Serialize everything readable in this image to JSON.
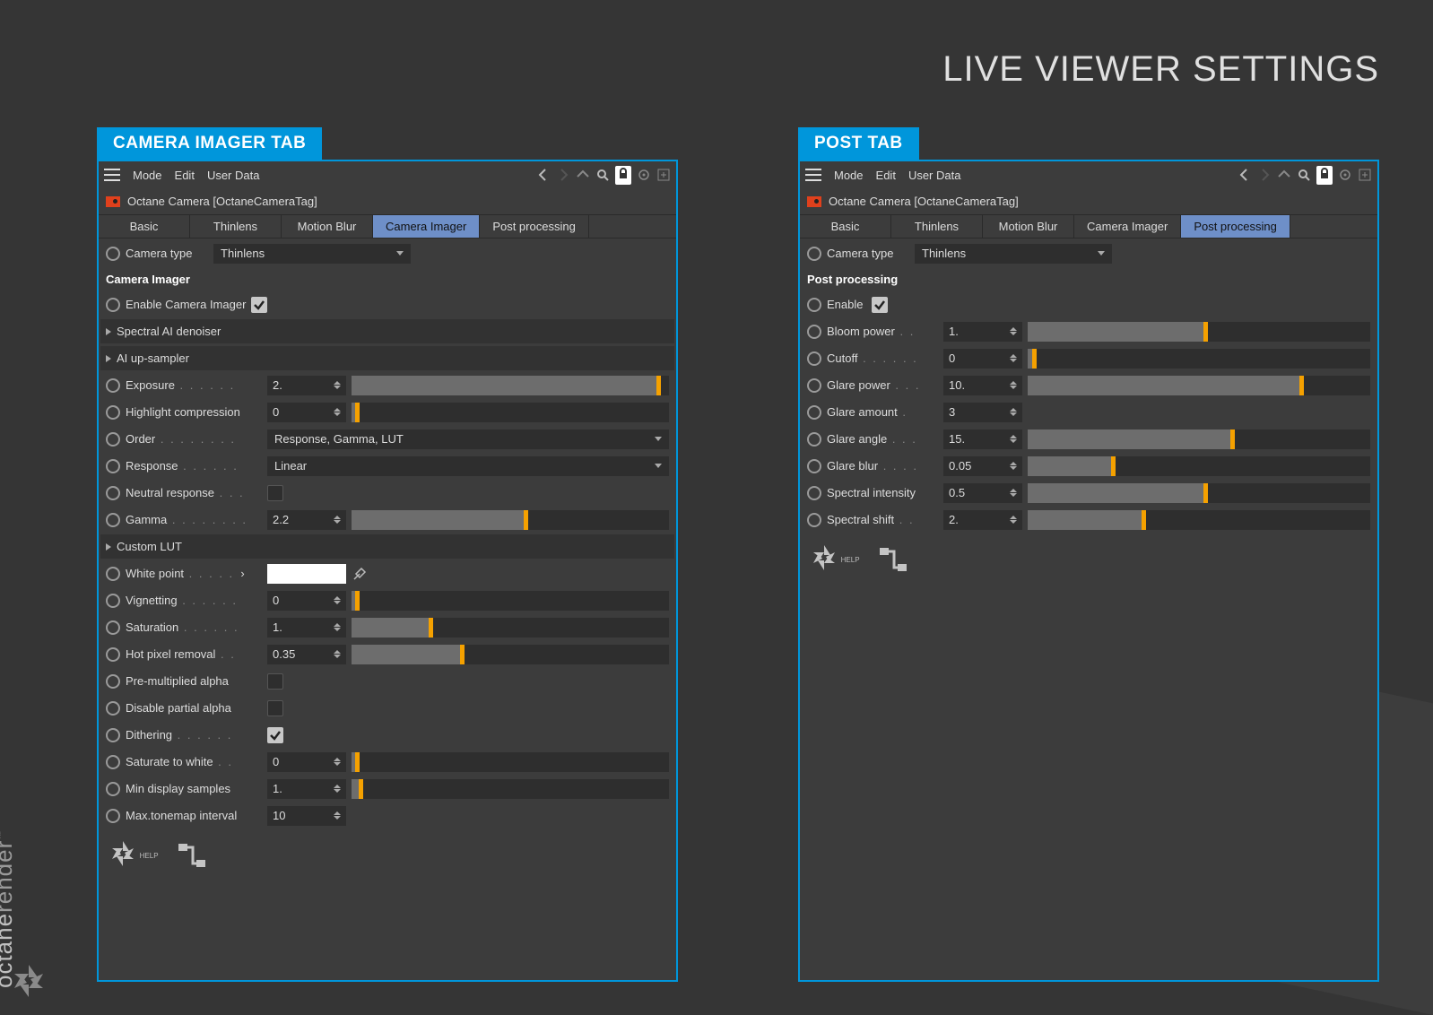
{
  "page_title": "LIVE VIEWER SETTINGS",
  "brand": {
    "first": "octane",
    "second": "render",
    "tm": "™"
  },
  "menus": {
    "mode": "Mode",
    "edit": "Edit",
    "userdata": "User Data"
  },
  "object_label": "Octane Camera [OctaneCameraTag]",
  "inner_tabs": [
    "Basic",
    "Thinlens",
    "Motion Blur",
    "Camera Imager",
    "Post processing"
  ],
  "camera_type": {
    "label": "Camera type",
    "value": "Thinlens"
  },
  "left": {
    "header": "CAMERA IMAGER TAB",
    "active_tab": 3,
    "section": "Camera Imager",
    "enable_label": "Enable Camera Imager",
    "groups": {
      "denoiser": "Spectral AI denoiser",
      "upsampler": "AI up-sampler",
      "lut": "Custom LUT"
    },
    "exposure": {
      "label": "Exposure",
      "value": "2.",
      "fill": 97
    },
    "highlight": {
      "label": "Highlight compression",
      "value": "0",
      "fill": 2
    },
    "order": {
      "label": "Order",
      "value": "Response, Gamma, LUT"
    },
    "response": {
      "label": "Response",
      "value": "Linear"
    },
    "neutral": {
      "label": "Neutral response"
    },
    "gamma": {
      "label": "Gamma",
      "value": "2.2",
      "fill": 55
    },
    "whitepoint": {
      "label": "White point"
    },
    "vignetting": {
      "label": "Vignetting",
      "value": "0",
      "fill": 2
    },
    "saturation": {
      "label": "Saturation",
      "value": "1.",
      "fill": 25
    },
    "hotpixel": {
      "label": "Hot pixel removal",
      "value": "0.35",
      "fill": 35
    },
    "premult": {
      "label": "Pre-multiplied alpha"
    },
    "disablepartial": {
      "label": "Disable partial alpha"
    },
    "dithering": {
      "label": "Dithering"
    },
    "saturate_white": {
      "label": "Saturate to white",
      "value": "0",
      "fill": 2
    },
    "min_display": {
      "label": "Min display samples",
      "value": "1.",
      "fill": 3
    },
    "max_tonemap": {
      "label": "Max.tonemap interval",
      "value": "10"
    }
  },
  "right": {
    "header": "POST TAB",
    "active_tab": 4,
    "section": "Post processing",
    "enable_label": "Enable",
    "bloom": {
      "label": "Bloom power",
      "value": "1.",
      "fill": 52
    },
    "cutoff": {
      "label": "Cutoff",
      "value": "0",
      "fill": 2
    },
    "glare_power": {
      "label": "Glare power",
      "value": "10.",
      "fill": 80
    },
    "glare_amount": {
      "label": "Glare amount",
      "value": "3"
    },
    "glare_angle": {
      "label": "Glare angle",
      "value": "15.",
      "fill": 60
    },
    "glare_blur": {
      "label": "Glare blur",
      "value": "0.05",
      "fill": 25
    },
    "spectral_intensity": {
      "label": "Spectral intensity",
      "value": "0.5",
      "fill": 52
    },
    "spectral_shift": {
      "label": "Spectral shift",
      "value": "2.",
      "fill": 34
    }
  },
  "help": "HELP"
}
